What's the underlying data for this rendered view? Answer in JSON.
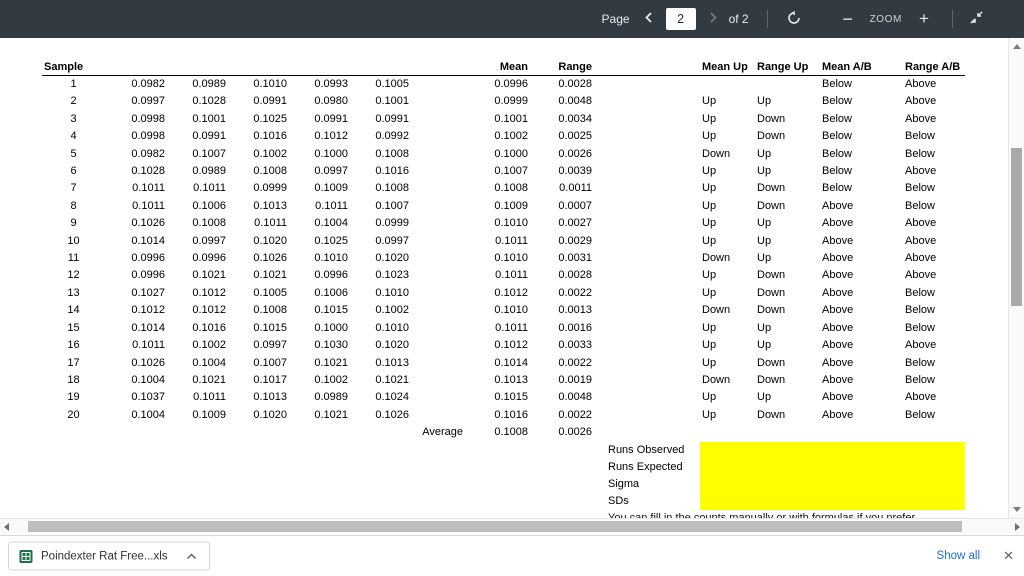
{
  "toolbar": {
    "page_label": "Page",
    "page_value": "2",
    "of_label": "of 2",
    "zoom_label": "ZOOM"
  },
  "sheet": {
    "headers": {
      "sample": "Sample",
      "mean": "Mean",
      "range": "Range",
      "mean_up": "Mean Up",
      "range_up": "Range Up",
      "mean_ab": "Mean A/B",
      "range_ab": "Range A/B"
    },
    "rows": [
      {
        "sample": "1",
        "values": [
          "0.0982",
          "0.0989",
          "0.1010",
          "0.0993",
          "0.1005"
        ],
        "mean": "0.0996",
        "range": "0.0028",
        "mean_up": "",
        "range_up": "",
        "mean_ab": "Below",
        "range_ab": "Above"
      },
      {
        "sample": "2",
        "values": [
          "0.0997",
          "0.1028",
          "0.0991",
          "0.0980",
          "0.1001"
        ],
        "mean": "0.0999",
        "range": "0.0048",
        "mean_up": "Up",
        "range_up": "Up",
        "mean_ab": "Below",
        "range_ab": "Above"
      },
      {
        "sample": "3",
        "values": [
          "0.0998",
          "0.1001",
          "0.1025",
          "0.0991",
          "0.0991"
        ],
        "mean": "0.1001",
        "range": "0.0034",
        "mean_up": "Up",
        "range_up": "Down",
        "mean_ab": "Below",
        "range_ab": "Above"
      },
      {
        "sample": "4",
        "values": [
          "0.0998",
          "0.0991",
          "0.1016",
          "0.1012",
          "0.0992"
        ],
        "mean": "0.1002",
        "range": "0.0025",
        "mean_up": "Up",
        "range_up": "Down",
        "mean_ab": "Below",
        "range_ab": "Below"
      },
      {
        "sample": "5",
        "values": [
          "0.0982",
          "0.1007",
          "0.1002",
          "0.1000",
          "0.1008"
        ],
        "mean": "0.1000",
        "range": "0.0026",
        "mean_up": "Down",
        "range_up": "Up",
        "mean_ab": "Below",
        "range_ab": "Below"
      },
      {
        "sample": "6",
        "values": [
          "0.1028",
          "0.0989",
          "0.1008",
          "0.0997",
          "0.1016"
        ],
        "mean": "0.1007",
        "range": "0.0039",
        "mean_up": "Up",
        "range_up": "Up",
        "mean_ab": "Below",
        "range_ab": "Above"
      },
      {
        "sample": "7",
        "values": [
          "0.1011",
          "0.1011",
          "0.0999",
          "0.1009",
          "0.1008"
        ],
        "mean": "0.1008",
        "range": "0.0011",
        "mean_up": "Up",
        "range_up": "Down",
        "mean_ab": "Below",
        "range_ab": "Below"
      },
      {
        "sample": "8",
        "values": [
          "0.1011",
          "0.1006",
          "0.1013",
          "0.1011",
          "0.1007"
        ],
        "mean": "0.1009",
        "range": "0.0007",
        "mean_up": "Up",
        "range_up": "Down",
        "mean_ab": "Above",
        "range_ab": "Below"
      },
      {
        "sample": "9",
        "values": [
          "0.1026",
          "0.1008",
          "0.1011",
          "0.1004",
          "0.0999"
        ],
        "mean": "0.1010",
        "range": "0.0027",
        "mean_up": "Up",
        "range_up": "Up",
        "mean_ab": "Above",
        "range_ab": "Above"
      },
      {
        "sample": "10",
        "values": [
          "0.1014",
          "0.0997",
          "0.1020",
          "0.1025",
          "0.0997"
        ],
        "mean": "0.1011",
        "range": "0.0029",
        "mean_up": "Up",
        "range_up": "Up",
        "mean_ab": "Above",
        "range_ab": "Above"
      },
      {
        "sample": "11",
        "values": [
          "0.0996",
          "0.0996",
          "0.1026",
          "0.1010",
          "0.1020"
        ],
        "mean": "0.1010",
        "range": "0.0031",
        "mean_up": "Down",
        "range_up": "Up",
        "mean_ab": "Above",
        "range_ab": "Above"
      },
      {
        "sample": "12",
        "values": [
          "0.0996",
          "0.1021",
          "0.1021",
          "0.0996",
          "0.1023"
        ],
        "mean": "0.1011",
        "range": "0.0028",
        "mean_up": "Up",
        "range_up": "Down",
        "mean_ab": "Above",
        "range_ab": "Above"
      },
      {
        "sample": "13",
        "values": [
          "0.1027",
          "0.1012",
          "0.1005",
          "0.1006",
          "0.1010"
        ],
        "mean": "0.1012",
        "range": "0.0022",
        "mean_up": "Up",
        "range_up": "Down",
        "mean_ab": "Above",
        "range_ab": "Below"
      },
      {
        "sample": "14",
        "values": [
          "0.1012",
          "0.1012",
          "0.1008",
          "0.1015",
          "0.1002"
        ],
        "mean": "0.1010",
        "range": "0.0013",
        "mean_up": "Down",
        "range_up": "Down",
        "mean_ab": "Above",
        "range_ab": "Below"
      },
      {
        "sample": "15",
        "values": [
          "0.1014",
          "0.1016",
          "0.1015",
          "0.1000",
          "0.1010"
        ],
        "mean": "0.1011",
        "range": "0.0016",
        "mean_up": "Up",
        "range_up": "Up",
        "mean_ab": "Above",
        "range_ab": "Below"
      },
      {
        "sample": "16",
        "values": [
          "0.1011",
          "0.1002",
          "0.0997",
          "0.1030",
          "0.1020"
        ],
        "mean": "0.1012",
        "range": "0.0033",
        "mean_up": "Up",
        "range_up": "Up",
        "mean_ab": "Above",
        "range_ab": "Above"
      },
      {
        "sample": "17",
        "values": [
          "0.1026",
          "0.1004",
          "0.1007",
          "0.1021",
          "0.1013"
        ],
        "mean": "0.1014",
        "range": "0.0022",
        "mean_up": "Up",
        "range_up": "Down",
        "mean_ab": "Above",
        "range_ab": "Below"
      },
      {
        "sample": "18",
        "values": [
          "0.1004",
          "0.1021",
          "0.1017",
          "0.1002",
          "0.1021"
        ],
        "mean": "0.1013",
        "range": "0.0019",
        "mean_up": "Down",
        "range_up": "Down",
        "mean_ab": "Above",
        "range_ab": "Below"
      },
      {
        "sample": "19",
        "values": [
          "0.1037",
          "0.1011",
          "0.1013",
          "0.0989",
          "0.1024"
        ],
        "mean": "0.1015",
        "range": "0.0048",
        "mean_up": "Up",
        "range_up": "Up",
        "mean_ab": "Above",
        "range_ab": "Above"
      },
      {
        "sample": "20",
        "values": [
          "0.1004",
          "0.1009",
          "0.1020",
          "0.1021",
          "0.1026"
        ],
        "mean": "0.1016",
        "range": "0.0022",
        "mean_up": "Up",
        "range_up": "Down",
        "mean_ab": "Above",
        "range_ab": "Below"
      }
    ],
    "average": {
      "label": "Average",
      "mean": "0.1008",
      "range": "0.0026"
    },
    "summary_labels": [
      "Runs Observed",
      "Runs Expected",
      "Sigma",
      "SDs"
    ],
    "note": "You can fill in the counts manually or with formulas if you prefer",
    "highlight_color": "#ffff00"
  },
  "download_bar": {
    "file_name": "Poindexter Rat Free...xls",
    "show_all_label": "Show all",
    "link_color": "#1a6fd4"
  }
}
